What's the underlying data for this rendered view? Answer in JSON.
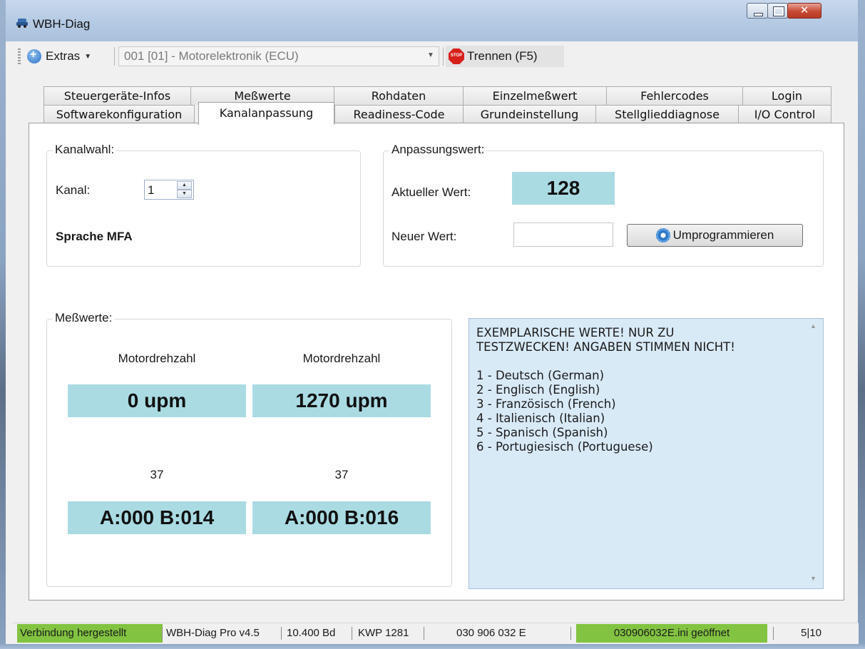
{
  "window": {
    "title": "WBH-Diag"
  },
  "toolbar": {
    "extras_label": "Extras",
    "ecu_select_value": "001 [01] - Motorelektronik (ECU)",
    "trennen_label": "Trennen (F5)",
    "stop_icon_text": "STOP"
  },
  "tabs": {
    "row1": [
      "Steuergeräte-Infos",
      "Meßwerte",
      "Rohdaten",
      "Einzelmeßwert",
      "Fehlercodes",
      "Login"
    ],
    "row2": [
      "Softwarekonfiguration",
      "Kanalanpassung",
      "Readiness-Code",
      "Grundeinstellung",
      "Stellglieddiagnose",
      "I/O Control"
    ],
    "active": "Kanalanpassung"
  },
  "kanalwahl": {
    "legend": "Kanalwahl:",
    "kanal_label": "Kanal:",
    "kanal_value": "1",
    "channel_name": "Sprache MFA"
  },
  "anpassungswert": {
    "legend": "Anpassungswert:",
    "aktueller_label": "Aktueller Wert:",
    "aktueller_value": "128",
    "neuer_label": "Neuer Wert:",
    "neuer_value": "",
    "button_label": "Umprogrammieren"
  },
  "messwerte": {
    "legend": "Meßwerte:",
    "cells": [
      {
        "title": "Motordrehzahl",
        "value": "0 upm"
      },
      {
        "title": "Motordrehzahl",
        "value": "1270 upm"
      },
      {
        "title": "37",
        "value": "A:000 B:014"
      },
      {
        "title": "37",
        "value": "A:000 B:016"
      }
    ],
    "value_color": "#aadbe3"
  },
  "info": {
    "text": "EXEMPLARISCHE WERTE! NUR ZU\nTESTZWECKEN! ANGABEN STIMMEN NICHT!\n\n1 - Deutsch (German)\n2 - Englisch (English)\n3 - Französisch (French)\n4 - Italienisch (Italian)\n5 - Spanisch (Spanish)\n6 - Portugiesisch (Portuguese)"
  },
  "statusbar": {
    "connection": "Verbindung hergestellt",
    "version": "WBH-Diag Pro v4.5",
    "baud": "10.400 Bd",
    "protocol": "KWP 1281",
    "part_number": "030 906 032 E",
    "file": "030906032E.ini geöffnet",
    "page": "5|10",
    "ok_color": "#82c341"
  }
}
